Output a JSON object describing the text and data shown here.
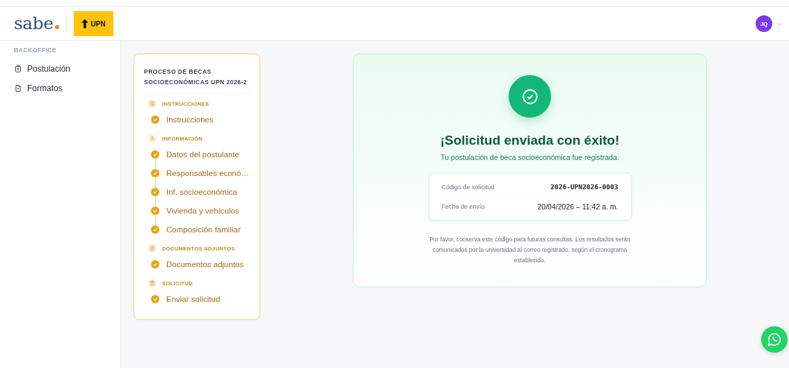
{
  "header": {
    "brand": "sabe",
    "partner_logo": "UPN",
    "avatar_initials": "JQ"
  },
  "sidebar": {
    "section_label": "BACKOFFICE",
    "items": [
      {
        "label": "Postulación",
        "kind": "clipboard",
        "selected": false
      },
      {
        "label": "Formatos",
        "kind": "file",
        "selected": false
      }
    ]
  },
  "steps_card": {
    "title": "PROCESO DE BECAS SOCIOECONÓMICAS UPN 2026-2",
    "sections": [
      {
        "label": "INSTRUCCIONES",
        "kind": "book",
        "steps": [
          {
            "label": "Instrucciones",
            "done": true
          }
        ]
      },
      {
        "label": "INFORMACIÓN",
        "kind": "user",
        "steps": [
          {
            "label": "Datos del postulante",
            "done": true
          },
          {
            "label": "Responsables econó…",
            "done": true
          },
          {
            "label": "Inf. socioeconómica",
            "done": true
          },
          {
            "label": "Vivienda y vehículos",
            "done": true
          },
          {
            "label": "Composición familiar",
            "done": true
          }
        ]
      },
      {
        "label": "DOCUMENTOS ADJUNTOS",
        "kind": "file",
        "steps": [
          {
            "label": "Documentos adjuntos",
            "done": true
          }
        ]
      },
      {
        "label": "SOLICITUD",
        "kind": "clipboard",
        "steps": [
          {
            "label": "Enviar solicitud",
            "done": true
          }
        ]
      }
    ]
  },
  "success_card": {
    "title": "¡Solicitud enviada con éxito!",
    "subtitle": "Tu postulación de beca socioeconómica fue registrada.",
    "details": [
      {
        "label": "Código de solicitud",
        "value": "2026-UPN2026-0003",
        "kind": "code"
      },
      {
        "label": "Fecha de envío",
        "value": "20/04/2026 – 11:42 a. m.",
        "kind": "text"
      }
    ],
    "note": "Por favor, conserva este código para futuras consultas. Los resultados serán comunicados por la universidad al correo registrado, según el cronograma establecido."
  }
}
